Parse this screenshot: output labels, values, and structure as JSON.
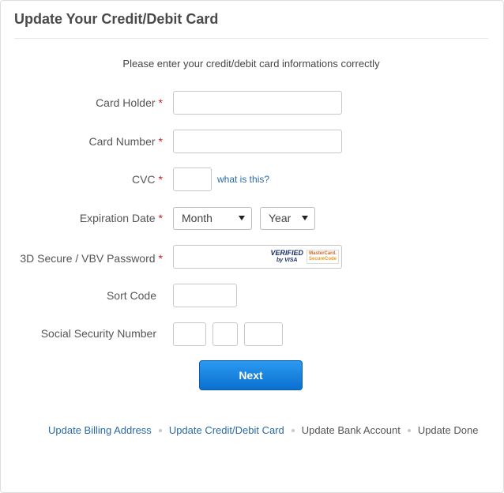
{
  "header": {
    "title": "Update Your Credit/Debit Card"
  },
  "intro": "Please enter your credit/debit card informations correctly",
  "required_mark": "*",
  "fields": {
    "card_holder": {
      "label": "Card Holder",
      "value": ""
    },
    "card_number": {
      "label": "Card Number",
      "value": ""
    },
    "cvc": {
      "label": "CVC",
      "value": "",
      "help_link": "what is this?"
    },
    "expiration": {
      "label": "Expiration Date",
      "month": "Month",
      "year": "Year"
    },
    "secure_password": {
      "label": "3D Secure / VBV Password",
      "value": ""
    },
    "sort_code": {
      "label": "Sort Code",
      "value": ""
    },
    "ssn": {
      "label": "Social Security Number",
      "part1": "",
      "part2": "",
      "part3": ""
    }
  },
  "secure_logos": {
    "visa_line1": "VERIFIED",
    "visa_line2": "by VISA",
    "mc_line1": "MasterCard.",
    "mc_line2": "SecureCode"
  },
  "next_button": "Next",
  "steps": [
    {
      "label": "Update Billing Address",
      "is_link": true
    },
    {
      "label": "Update Credit/Debit Card",
      "is_link": true
    },
    {
      "label": "Update Bank Account",
      "is_link": false
    },
    {
      "label": "Update Done",
      "is_link": false
    }
  ],
  "colors": {
    "link": "#2a6aa6",
    "button": "#1580de",
    "required": "#c81e1e"
  }
}
